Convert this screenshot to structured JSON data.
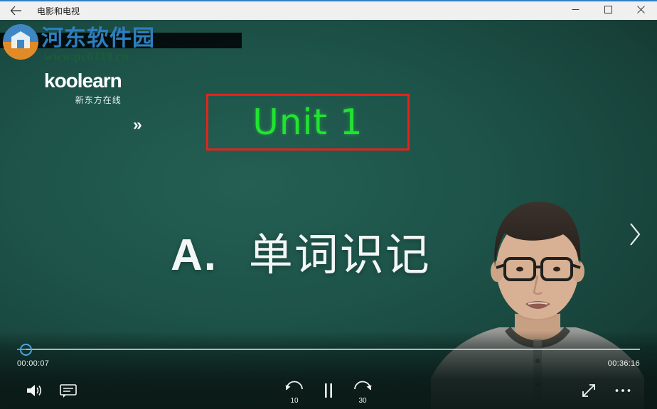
{
  "window": {
    "title": "电影和电视",
    "back_icon": "back-arrow-icon",
    "minimize_label": "—",
    "maximize_label": "□",
    "close_label": "✕"
  },
  "watermark": {
    "site_name": "河东软件园",
    "url": "www.pc0359.cn",
    "emblem_icon": "site-logo-icon"
  },
  "slide": {
    "brand": {
      "name": "koolearn",
      "chevron": "»",
      "subtitle": "新东方在线"
    },
    "unit_title": "Unit 1",
    "unit_border_color": "#e5231b",
    "unit_text_color": "#22e331",
    "section_prefix": "A.",
    "section_title": "单词识记",
    "background_color": "#1d5349"
  },
  "navigation": {
    "next_icon": "chevron-right-icon"
  },
  "player": {
    "current_time": "00:00:07",
    "total_time": "00:36:16",
    "progress_percent": 0.3,
    "accent_color": "#4aa3e0",
    "controls": {
      "volume": {
        "label": "Volume",
        "icon": "volume-icon"
      },
      "captions": {
        "label": "Closed captions",
        "icon": "closed-captions-icon"
      },
      "rewind": {
        "label": "Rewind",
        "icon": "rewind-icon",
        "seconds": "10"
      },
      "play_pause": {
        "label": "Pause",
        "icon": "pause-icon"
      },
      "forward": {
        "label": "Fast forward",
        "icon": "fast-forward-icon",
        "seconds": "30"
      },
      "fullscreen": {
        "label": "Full screen",
        "icon": "fullscreen-icon"
      },
      "more": {
        "label": "More options",
        "icon": "more-options-icon"
      }
    }
  }
}
